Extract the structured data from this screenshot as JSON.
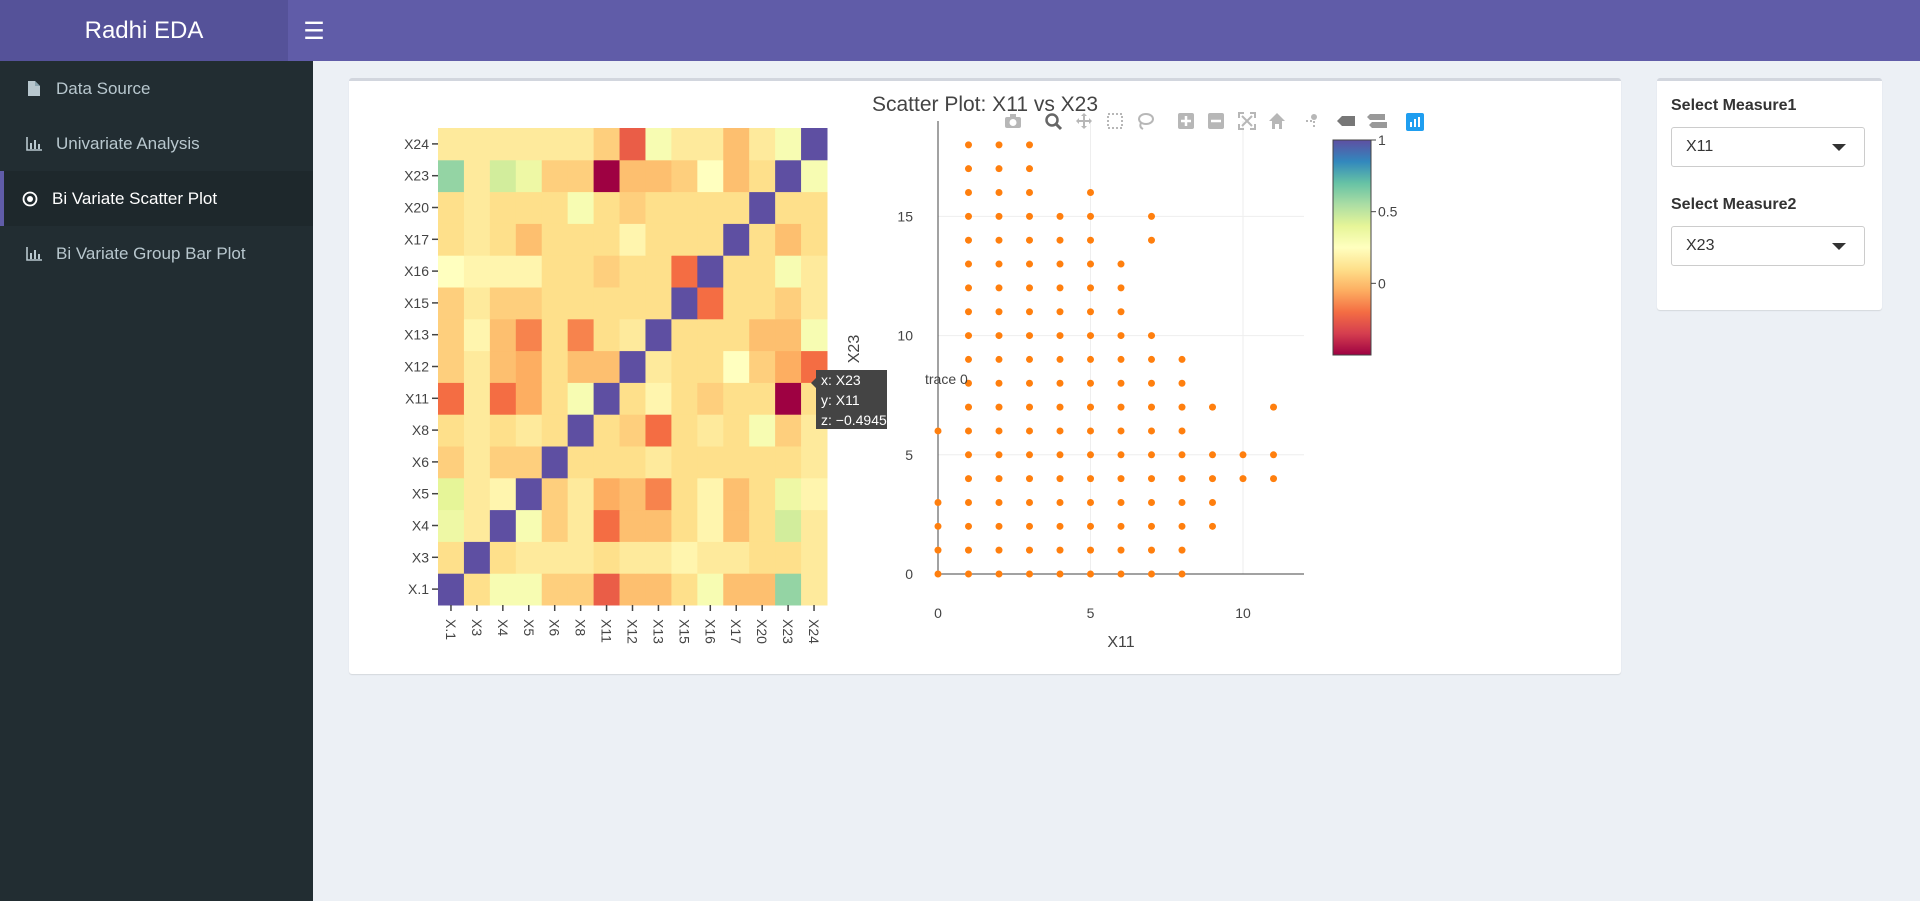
{
  "app": {
    "title": "Radhi EDA"
  },
  "sidebar": {
    "items": [
      {
        "label": "Data Source",
        "icon": "file-icon"
      },
      {
        "label": "Univariate Analysis",
        "icon": "bar-chart-icon"
      },
      {
        "label": "Bi Variate Scatter Plot",
        "icon": "radio-dot-icon"
      },
      {
        "label": "Bi Variate Group Bar Plot",
        "icon": "bar-chart-icon"
      }
    ],
    "active_index": 2
  },
  "controls": {
    "measure1_label": "Select Measure1",
    "measure1_value": "X11",
    "measure2_label": "Select Measure2",
    "measure2_value": "X23"
  },
  "plot_title": "Scatter Plot: X11 vs X23",
  "colors": {
    "topbar": "#605ca8",
    "brand": "#555299",
    "sidebar": "#222d32",
    "marker": "#ff7f0e",
    "modebar_active": "#1f9ef0"
  },
  "modebar": [
    "camera-icon",
    "zoom-icon",
    "pan-icon",
    "box-select-icon",
    "lasso-icon",
    "zoom-in-icon",
    "zoom-out-icon",
    "autoscale-icon",
    "home-icon",
    "spike-lines-icon",
    "hover-closest-icon",
    "hover-compare-icon",
    "plotly-logo-icon"
  ],
  "tooltip": {
    "x": "x: X23",
    "y": "y: X11",
    "z": "z: −0.4945479",
    "trace": "trace 0"
  },
  "chart_data": [
    {
      "type": "heatmap",
      "x_labels": [
        "X.1",
        "X3",
        "X4",
        "X5",
        "X6",
        "X8",
        "X11",
        "X12",
        "X13",
        "X15",
        "X16",
        "X17",
        "X20",
        "X23",
        "X24"
      ],
      "y_labels": [
        "X.1",
        "X3",
        "X4",
        "X5",
        "X6",
        "X8",
        "X11",
        "X12",
        "X13",
        "X15",
        "X16",
        "X17",
        "X20",
        "X23",
        "X24"
      ],
      "z": [
        [
          1,
          0.1,
          0.3,
          0.3,
          0.05,
          0.05,
          -0.25,
          0.0,
          0.0,
          0.1,
          0.3,
          0.0,
          0.0,
          0.6,
          0.15
        ],
        [
          0.1,
          1,
          0.1,
          0.15,
          0.15,
          0.15,
          0.1,
          0.15,
          0.15,
          0.2,
          0.15,
          0.15,
          0.1,
          0.1,
          0.15
        ],
        [
          0.35,
          0.15,
          1,
          0.3,
          0.05,
          0.15,
          -0.2,
          0.0,
          0.0,
          0.1,
          0.2,
          0.0,
          0.1,
          0.45,
          0.15
        ],
        [
          0.4,
          0.15,
          0.2,
          1,
          0.05,
          0.15,
          -0.05,
          0.0,
          -0.15,
          0.1,
          0.2,
          0.0,
          0.1,
          0.35,
          0.2
        ],
        [
          0.05,
          0.15,
          0.05,
          0.05,
          1,
          0.1,
          0.1,
          0.1,
          0.15,
          0.1,
          0.1,
          0.1,
          0.1,
          0.1,
          0.15
        ],
        [
          0.1,
          0.15,
          0.1,
          0.15,
          0.1,
          1,
          0.1,
          0.05,
          -0.2,
          0.1,
          0.15,
          0.1,
          0.3,
          0.05,
          0.15
        ],
        [
          -0.2,
          0.15,
          -0.2,
          -0.05,
          0.1,
          0.3,
          1,
          0.1,
          0.2,
          0.1,
          0.05,
          0.1,
          0.1,
          -0.5,
          0.1
        ],
        [
          0.05,
          0.15,
          0.0,
          -0.05,
          0.1,
          0.0,
          0.0,
          1,
          0.15,
          0.1,
          0.1,
          0.25,
          0.05,
          -0.05,
          -0.2
        ],
        [
          0.05,
          0.2,
          0.0,
          -0.15,
          0.1,
          -0.15,
          0.1,
          0.15,
          1,
          0.1,
          0.1,
          0.1,
          0.0,
          0.0,
          0.3
        ],
        [
          0.05,
          0.15,
          0.05,
          0.05,
          0.1,
          0.1,
          0.1,
          0.1,
          0.1,
          1,
          -0.2,
          0.1,
          0.1,
          0.05,
          0.15
        ],
        [
          0.25,
          0.2,
          0.2,
          0.2,
          0.1,
          0.1,
          0.05,
          0.1,
          0.1,
          -0.2,
          1,
          0.1,
          0.1,
          0.3,
          0.15
        ],
        [
          0.1,
          0.15,
          0.1,
          0.0,
          0.1,
          0.1,
          0.1,
          0.2,
          0.1,
          0.1,
          0.1,
          1,
          0.1,
          0.0,
          0.1
        ],
        [
          0.1,
          0.15,
          0.1,
          0.1,
          0.1,
          0.3,
          0.1,
          0.05,
          0.1,
          0.1,
          0.1,
          0.1,
          1,
          0.1,
          0.1
        ],
        [
          0.6,
          0.15,
          0.45,
          0.35,
          0.05,
          0.05,
          -0.5,
          0.0,
          0.0,
          0.05,
          0.25,
          0.0,
          0.1,
          1,
          0.3
        ],
        [
          0.15,
          0.15,
          0.15,
          0.15,
          0.15,
          0.15,
          0.05,
          -0.25,
          0.3,
          0.15,
          0.15,
          0.0,
          0.15,
          0.3,
          1
        ]
      ],
      "colorbar": {
        "ticks": [
          "1",
          "0.5",
          "0"
        ],
        "range": [
          -0.5,
          1
        ]
      }
    },
    {
      "type": "scatter",
      "xlabel": "X11",
      "ylabel": "X23",
      "x_ticks": [
        "0",
        "5",
        "10"
      ],
      "y_ticks": [
        "0",
        "5",
        "10",
        "15"
      ],
      "xlim": [
        0,
        12
      ],
      "ylim": [
        0,
        19
      ],
      "points": [
        [
          0,
          0
        ],
        [
          0,
          1
        ],
        [
          0,
          2
        ],
        [
          0,
          3
        ],
        [
          0,
          6
        ],
        [
          1,
          0
        ],
        [
          1,
          1
        ],
        [
          1,
          2
        ],
        [
          1,
          3
        ],
        [
          1,
          4
        ],
        [
          1,
          5
        ],
        [
          1,
          6
        ],
        [
          1,
          7
        ],
        [
          1,
          8
        ],
        [
          1,
          9
        ],
        [
          1,
          10
        ],
        [
          1,
          11
        ],
        [
          1,
          12
        ],
        [
          1,
          13
        ],
        [
          1,
          14
        ],
        [
          1,
          15
        ],
        [
          1,
          16
        ],
        [
          1,
          17
        ],
        [
          1,
          18
        ],
        [
          2,
          0
        ],
        [
          2,
          1
        ],
        [
          2,
          2
        ],
        [
          2,
          3
        ],
        [
          2,
          4
        ],
        [
          2,
          5
        ],
        [
          2,
          6
        ],
        [
          2,
          7
        ],
        [
          2,
          8
        ],
        [
          2,
          9
        ],
        [
          2,
          10
        ],
        [
          2,
          11
        ],
        [
          2,
          12
        ],
        [
          2,
          13
        ],
        [
          2,
          14
        ],
        [
          2,
          15
        ],
        [
          2,
          16
        ],
        [
          2,
          17
        ],
        [
          2,
          18
        ],
        [
          3,
          0
        ],
        [
          3,
          1
        ],
        [
          3,
          2
        ],
        [
          3,
          3
        ],
        [
          3,
          4
        ],
        [
          3,
          5
        ],
        [
          3,
          6
        ],
        [
          3,
          7
        ],
        [
          3,
          8
        ],
        [
          3,
          9
        ],
        [
          3,
          10
        ],
        [
          3,
          11
        ],
        [
          3,
          12
        ],
        [
          3,
          13
        ],
        [
          3,
          14
        ],
        [
          3,
          15
        ],
        [
          3,
          16
        ],
        [
          3,
          17
        ],
        [
          3,
          18
        ],
        [
          4,
          0
        ],
        [
          4,
          1
        ],
        [
          4,
          2
        ],
        [
          4,
          3
        ],
        [
          4,
          4
        ],
        [
          4,
          5
        ],
        [
          4,
          6
        ],
        [
          4,
          7
        ],
        [
          4,
          8
        ],
        [
          4,
          9
        ],
        [
          4,
          10
        ],
        [
          4,
          11
        ],
        [
          4,
          12
        ],
        [
          4,
          13
        ],
        [
          4,
          14
        ],
        [
          4,
          15
        ],
        [
          5,
          0
        ],
        [
          5,
          1
        ],
        [
          5,
          2
        ],
        [
          5,
          3
        ],
        [
          5,
          4
        ],
        [
          5,
          5
        ],
        [
          5,
          6
        ],
        [
          5,
          7
        ],
        [
          5,
          8
        ],
        [
          5,
          9
        ],
        [
          5,
          10
        ],
        [
          5,
          11
        ],
        [
          5,
          12
        ],
        [
          5,
          13
        ],
        [
          5,
          14
        ],
        [
          5,
          15
        ],
        [
          5,
          16
        ],
        [
          6,
          0
        ],
        [
          6,
          1
        ],
        [
          6,
          2
        ],
        [
          6,
          3
        ],
        [
          6,
          4
        ],
        [
          6,
          5
        ],
        [
          6,
          6
        ],
        [
          6,
          7
        ],
        [
          6,
          8
        ],
        [
          6,
          9
        ],
        [
          6,
          10
        ],
        [
          6,
          11
        ],
        [
          6,
          12
        ],
        [
          6,
          13
        ],
        [
          7,
          0
        ],
        [
          7,
          1
        ],
        [
          7,
          2
        ],
        [
          7,
          3
        ],
        [
          7,
          4
        ],
        [
          7,
          5
        ],
        [
          7,
          6
        ],
        [
          7,
          7
        ],
        [
          7,
          8
        ],
        [
          7,
          9
        ],
        [
          7,
          10
        ],
        [
          7,
          14
        ],
        [
          7,
          15
        ],
        [
          8,
          0
        ],
        [
          8,
          1
        ],
        [
          8,
          2
        ],
        [
          8,
          3
        ],
        [
          8,
          4
        ],
        [
          8,
          5
        ],
        [
          8,
          6
        ],
        [
          8,
          7
        ],
        [
          8,
          8
        ],
        [
          8,
          9
        ],
        [
          9,
          2
        ],
        [
          9,
          3
        ],
        [
          9,
          4
        ],
        [
          9,
          5
        ],
        [
          9,
          7
        ],
        [
          10,
          4
        ],
        [
          10,
          5
        ],
        [
          11,
          4
        ],
        [
          11,
          5
        ],
        [
          11,
          7
        ]
      ]
    }
  ]
}
